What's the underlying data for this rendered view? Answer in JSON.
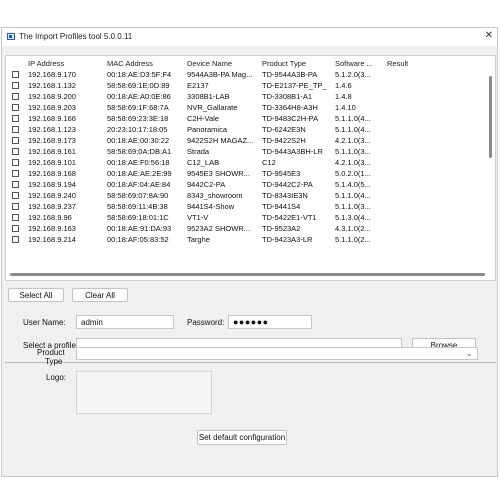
{
  "window": {
    "title": "The Import Profiles tool 5.0.0.11",
    "close_glyph": "✕"
  },
  "table": {
    "columns": [
      "IP Address",
      "MAC Address",
      "Device Name",
      "Product Type",
      "Software ...",
      "Result"
    ],
    "rows": [
      {
        "ip": "192.168.9.170",
        "mac": "00:18:AE:D3:5F:F4",
        "device": "9544A3B-PA Mag...",
        "product": "TD-9544A3B-PA",
        "software": "5.1.2.0(3...",
        "result": ""
      },
      {
        "ip": "192.168.1.132",
        "mac": "58:58:69:1E:0D:89",
        "device": "E2137",
        "product": "TD-E2137-PE_TP_",
        "software": "1.4.6",
        "result": ""
      },
      {
        "ip": "192.168.9.200",
        "mac": "00:18:AE:A0:0E:86",
        "device": "3308B1-LAB",
        "product": "TD-3308B1-A1",
        "software": "1.4.8",
        "result": ""
      },
      {
        "ip": "192.168.9.203",
        "mac": "58:58:69:1F:68:7A",
        "device": "NVR_Gallarate",
        "product": "TD-3364H8-A3H",
        "software": "1.4.10",
        "result": ""
      },
      {
        "ip": "192.168.9.166",
        "mac": "58:58:69:23:3E:18",
        "device": "C2H-Vale",
        "product": "TD-9483C2H-PA",
        "software": "5.1.1.0(4...",
        "result": ""
      },
      {
        "ip": "192.168.1.123",
        "mac": "20:23:10:17:18:05",
        "device": "Panoramica",
        "product": "TD-6242E3N",
        "software": "5.1.1.0(4...",
        "result": ""
      },
      {
        "ip": "192.168.9.173",
        "mac": "00:18:AE:00:30:22",
        "device": "9422S2H MAGAZ...",
        "product": "TD-9422S2H",
        "software": "4.2.1.0(3...",
        "result": ""
      },
      {
        "ip": "192.168.9.161",
        "mac": "58:58:69:0A:DB:A1",
        "device": "Strada",
        "product": "TD-9443A3BH-LR",
        "software": "5.1.1.0(3...",
        "result": ""
      },
      {
        "ip": "192.168.9.101",
        "mac": "00:18:AE:F0:56:18",
        "device": "C12_LAB",
        "product": "C12",
        "software": "4.2.1.0(3...",
        "result": ""
      },
      {
        "ip": "192.168.9.168",
        "mac": "00:18:AE:AE:2E:99",
        "device": "9545E3 SHOWR...",
        "product": "TD-9545E3",
        "software": "5.0.2.0(1...",
        "result": ""
      },
      {
        "ip": "192.168.9.194",
        "mac": "00:18:AF:04:AE:84",
        "device": "9442C2-PA",
        "product": "TD-9442C2-PA",
        "software": "5.1.4.0(5...",
        "result": ""
      },
      {
        "ip": "192.168.9.240",
        "mac": "58:58:69:07:8A:90",
        "device": "8343_showroom",
        "product": "TD-8343IE3N",
        "software": "5.1.1.0(4...",
        "result": ""
      },
      {
        "ip": "192.168.9.237",
        "mac": "58:58:69:11:4B:38",
        "device": "9441S4-Show",
        "product": "TD-9441S4",
        "software": "5.1.1.0(3...",
        "result": ""
      },
      {
        "ip": "192.168.9.96",
        "mac": "58:58:69:18:01:1C",
        "device": "VT1-V",
        "product": "TD-5422E1-VT1",
        "software": "5.1.3.0(4...",
        "result": ""
      },
      {
        "ip": "192.168.9.163",
        "mac": "00:18:AE:91:DA:93",
        "device": "9523A2 SHOWR...",
        "product": "TD-9523A2",
        "software": "4.3.1.0(2...",
        "result": ""
      },
      {
        "ip": "192.168.9.214",
        "mac": "00:18:AF:05:83:52",
        "device": "Targhe",
        "product": "TD-9423A3-LR",
        "software": "5.1.1.0(2...",
        "result": ""
      }
    ]
  },
  "buttons": {
    "select_all": "Select All",
    "clear_all": "Clear All",
    "browse": "Browse",
    "set_default": "Set default configuration"
  },
  "credentials": {
    "user_label": "User Name:",
    "user_value": "admin",
    "password_label": "Password:",
    "password_value": "●●●●●●"
  },
  "profile": {
    "label": "Select a profile",
    "value": ""
  },
  "product_type": {
    "label_line1": "Product",
    "label_line2": "Type",
    "value": "",
    "chevron_icon": "chevron-down-icon"
  },
  "logo": {
    "label": "Logo:"
  }
}
